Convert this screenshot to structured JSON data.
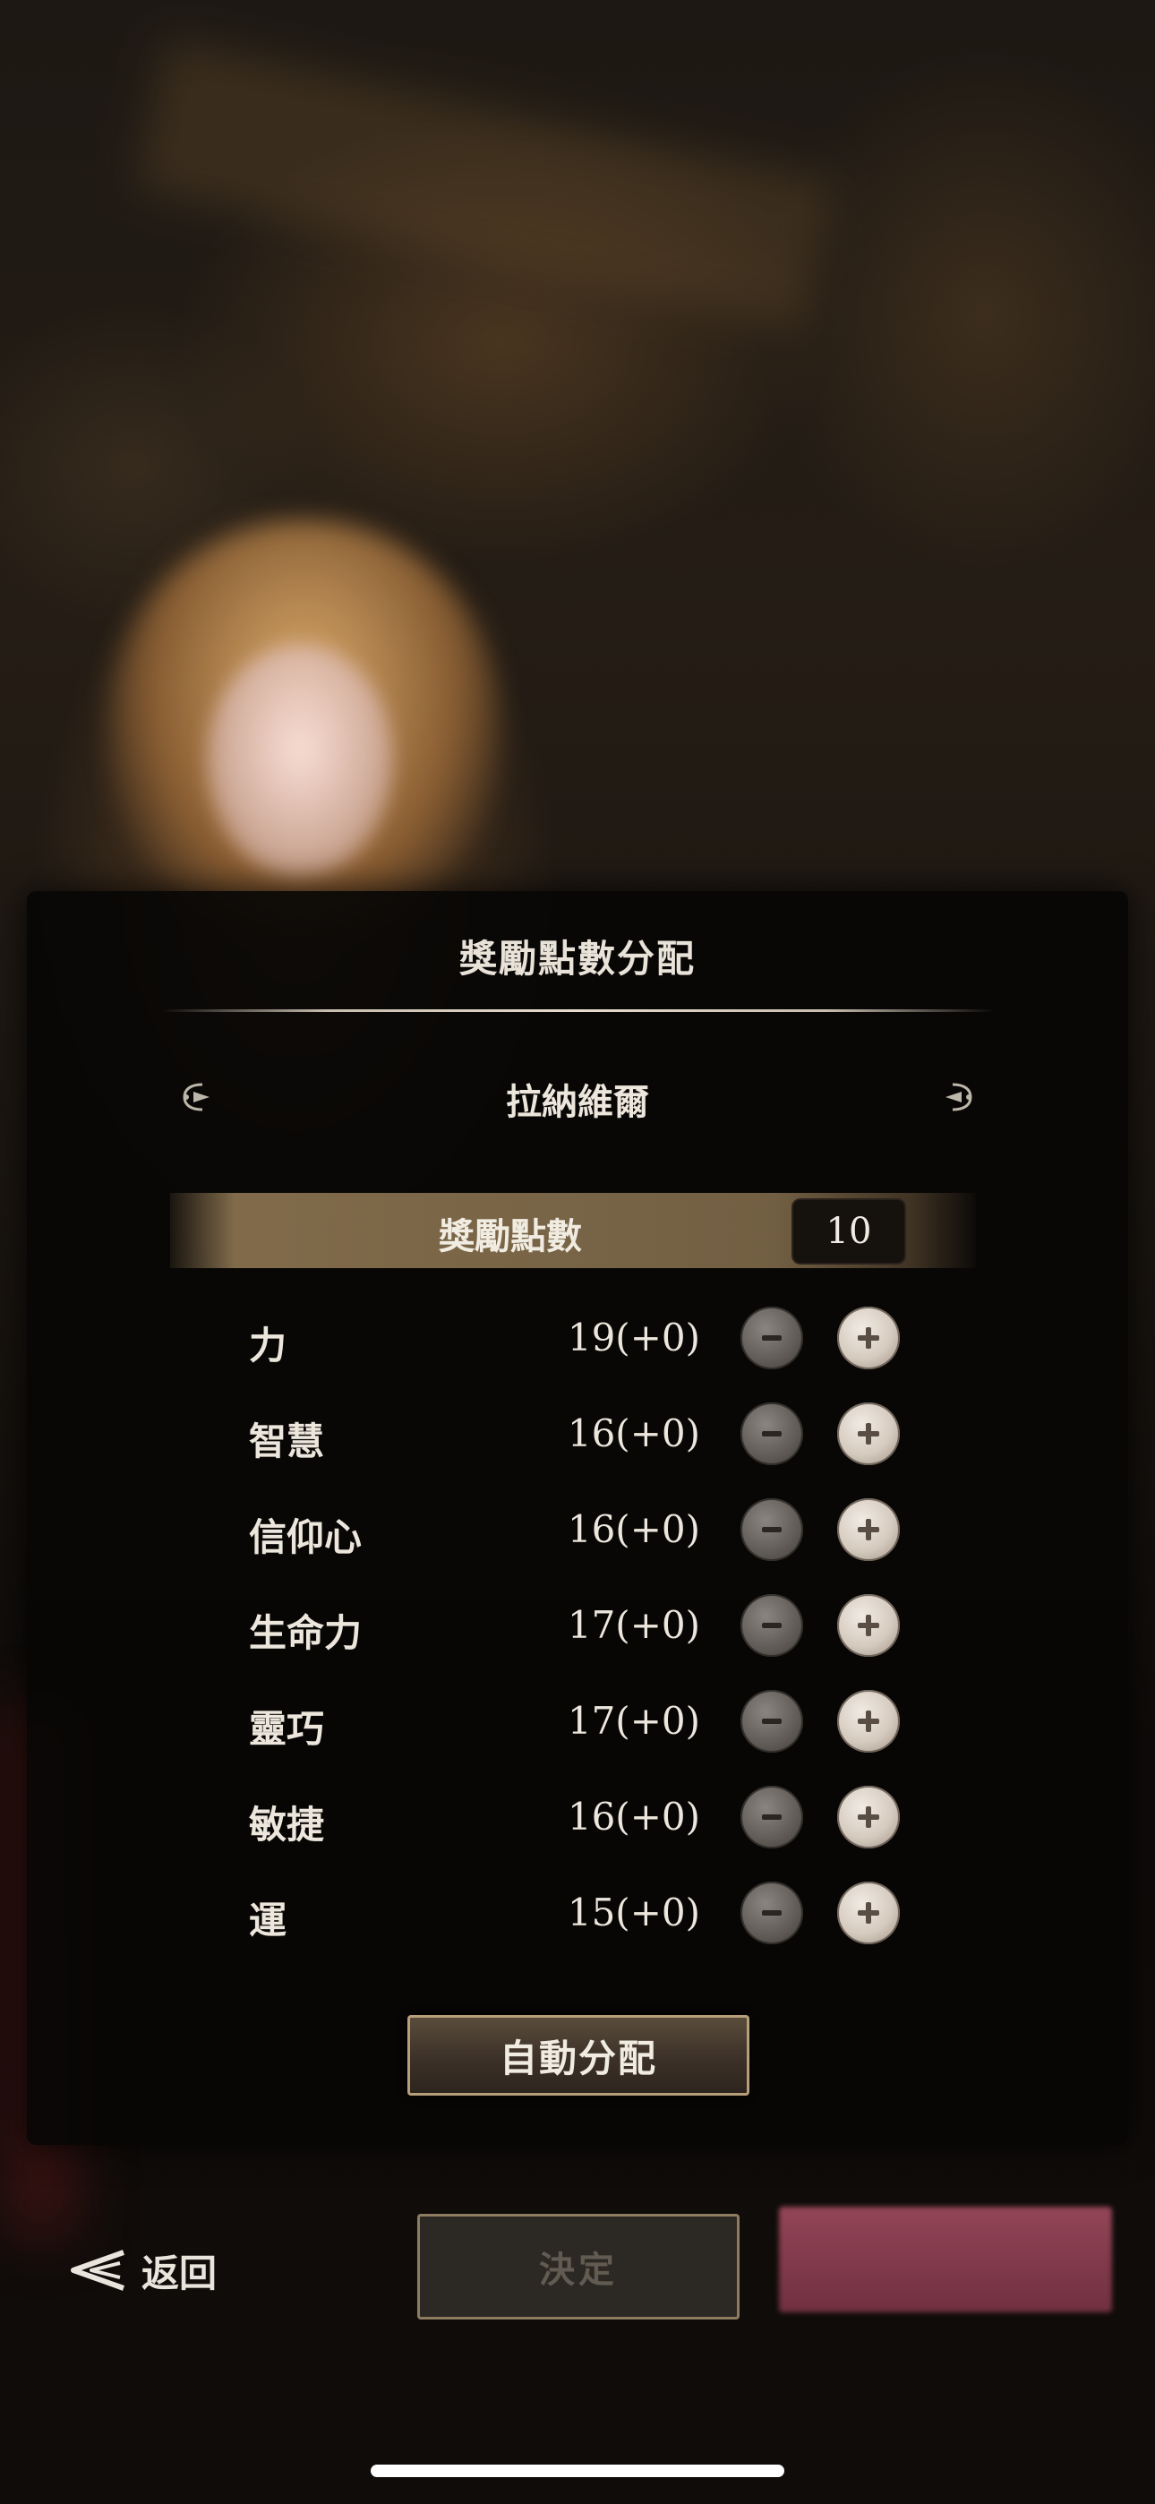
{
  "dialog": {
    "title": "獎勵點數分配",
    "character_name": "拉納維爾",
    "bonus_points_label": "獎勵點數",
    "bonus_points_value": "10",
    "stats": [
      {
        "name": "力",
        "value": "19(+0)"
      },
      {
        "name": "智慧",
        "value": "16(+0)"
      },
      {
        "name": "信仰心",
        "value": "16(+0)"
      },
      {
        "name": "生命力",
        "value": "17(+0)"
      },
      {
        "name": "靈巧",
        "value": "17(+0)"
      },
      {
        "name": "敏捷",
        "value": "16(+0)"
      },
      {
        "name": "運",
        "value": "15(+0)"
      }
    ],
    "auto_assign_label": "自動分配"
  },
  "bottom_bar": {
    "back_label": "返回",
    "confirm_label": "決定"
  },
  "icons": {
    "prev_character": "arrow-left-icon",
    "next_character": "arrow-right-icon",
    "decrease": "minus-icon",
    "increase": "plus-icon",
    "back": "back-arrow-icon"
  },
  "colors": {
    "panel_bg": "#080605",
    "points_bar": "#877050",
    "button_border": "#b6a07a",
    "accent_pink": "#aa5064"
  }
}
